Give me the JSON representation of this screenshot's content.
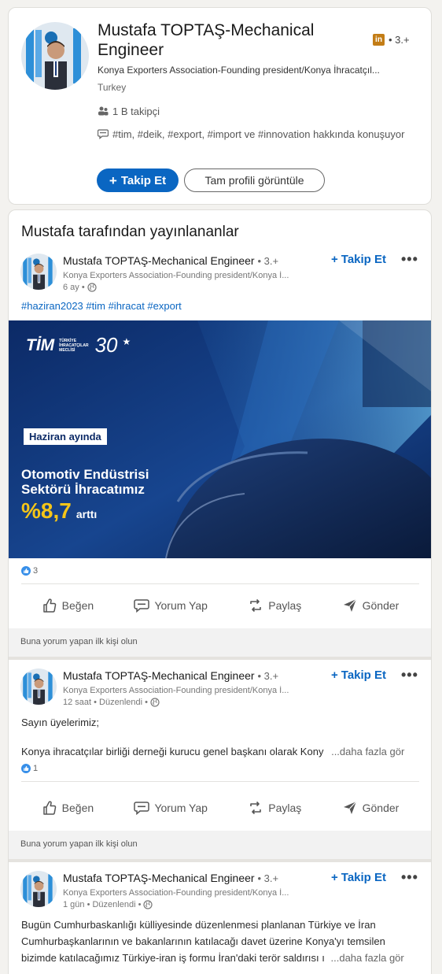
{
  "profile": {
    "name": "Mustafa TOPTAŞ-Mechanical Engineer",
    "linkedin_badge": "in",
    "degree": "• 3.+",
    "headline": "Konya Exporters Association-Founding president/Konya İhracatçıl...",
    "location": "Turkey",
    "followers": "1 B takipçi",
    "talks_about": "#tim, #deik, #export, #import ve #innovation hakkında konuşuyor",
    "follow_label": "Takip Et",
    "view_profile_label": "Tam profili görüntüle"
  },
  "posts_section": {
    "title": "Mustafa tarafından yayınlananlar"
  },
  "common": {
    "author": "Mustafa TOPTAŞ-Mechanical Engineer",
    "degree": "• 3.+",
    "headline": "Konya Exporters Association-Founding president/Konya İ...",
    "follow_label": "Takip Et",
    "more": "•••",
    "like": "Beğen",
    "comment": "Yorum Yap",
    "share": "Paylaş",
    "send": "Gönder",
    "comment_prompt": "Buna yorum yapan ilk kişi olun",
    "see_more": "...daha fazla gör"
  },
  "posts": [
    {
      "time": "6 ay •",
      "hashtags": "#haziran2023 #tim #ihracat #export",
      "reactions": "3",
      "banner": {
        "org": "TİM",
        "org_sub": [
          "TÜRKİYE",
          "İHRACATÇILAR",
          "MECLİSİ"
        ],
        "anniversary": "30",
        "tag": "Haziran ayında",
        "line1": "Otomotiv Endüstrisi",
        "line2": "Sektörü İhracatımız",
        "percent": "%8,7",
        "verb": "arttı"
      }
    },
    {
      "time": "12 saat • Düzenlendi •",
      "text_line1": "Sayın üyelerimiz;",
      "text_line2": "Konya ihracatçılar birliği derneği kurucu genel başkanı olarak Kony",
      "reactions": "1"
    },
    {
      "time": "1 gün • Düzenlendi •",
      "text_line1": "Bugün Cumhurbaskanlığı külliyesinde düzenlenmesi planlanan Türkiye ve İran",
      "text_line2": "Cumhurbaşkanlarının ve bakanlarının katılacağı davet üzerine Konya'yı temsilen",
      "text_line3": "bizimde katılacağımız Türkiye-iran iş formu İran'daki terör saldırısı ı"
    }
  ],
  "colors": {
    "accent": "#0a66c2",
    "linkedin_gold": "#c37d16",
    "banner_navy": "#0c2a66",
    "banner_percent": "#f5c518"
  }
}
